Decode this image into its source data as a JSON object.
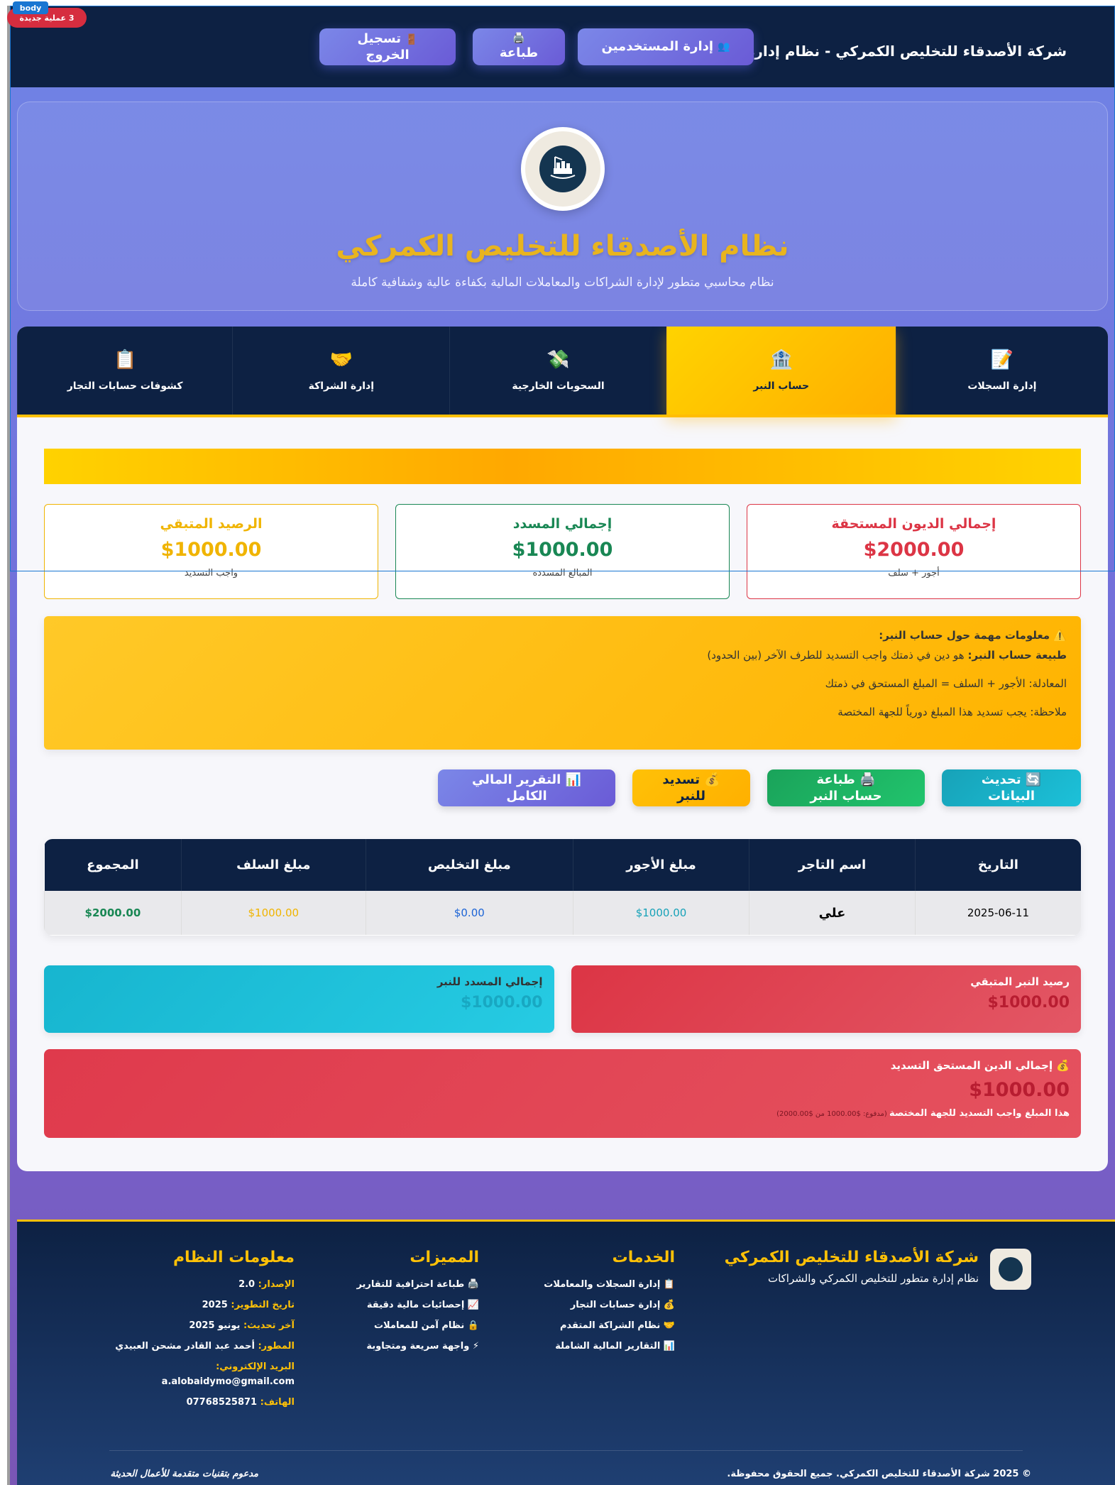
{
  "header": {
    "brand": "شركة الأصدقاء للتخليص الكمركي - نظام إدارة متكامل",
    "users_button": "إدارة المستخدمين",
    "print_button": "طباعة",
    "logout_button": "تسجيل الخروج"
  },
  "hero": {
    "title": "نظام الأصدقاء للتخليص الكمركي",
    "subtitle": "نظام محاسبي متطور لإدارة الشراكات والمعاملات المالية بكفاءة عالية وشفافية كاملة"
  },
  "tabs": [
    {
      "label": "إدارة السجلات",
      "icon": "📝"
    },
    {
      "label": "حساب النبر",
      "icon": "🏦"
    },
    {
      "label": "السحوبات الخارجية",
      "icon": "💸"
    },
    {
      "label": "إدارة الشراكة",
      "icon": "🤝"
    },
    {
      "label": "كشوفات حسابات التجار",
      "icon": "📋"
    }
  ],
  "cards": [
    {
      "title": "إجمالي الديون المستحقة",
      "value": "$2000.00",
      "sub": "أجور + سلف",
      "color": "#dc3545"
    },
    {
      "title": "إجمالي المسدد",
      "value": "$1000.00",
      "sub": "المبالغ المسددة",
      "color": "#198754"
    },
    {
      "title": "الرصيد المتبقي",
      "value": "$1000.00",
      "sub": "واجب التسديد",
      "color": "#f0b400"
    }
  ],
  "info": {
    "title": "⚠️ معلومات مهمة حول حساب النبر:",
    "nature_label": "طبيعة حساب النبر:",
    "nature_text": " هو دين في ذمتك واجب التسديد للطرف الآخر (بين الحدود)",
    "formula_label": "المعادلة:",
    "formula_text": " الأجور + السلف = المبلغ المستحق في ذمتك",
    "note_label": "ملاحظة:",
    "note_text": " يجب تسديد هذا المبلغ دورياً للجهة المختصة"
  },
  "actions": {
    "refresh": "🔄 تحديث البيانات",
    "print": "🖨️ طباعة حساب النبر",
    "pay": "💰 تسديد للنبر",
    "report": "📊 التقرير المالي الكامل"
  },
  "table": {
    "headers": [
      "التاريخ",
      "اسم التاجر",
      "مبلغ الأجور",
      "مبلغ التخليص",
      "مبلغ السلف",
      "المجموع"
    ],
    "rows": [
      [
        "2025-06-11",
        "علي",
        "$1000.00",
        "$0.00",
        "$1000.00",
        "$2000.00"
      ]
    ]
  },
  "summary": {
    "remaining_label": "رصيد النبر المتبقي",
    "remaining_value": "$1000.00",
    "paid_label": "إجمالي المسدد للنبر",
    "paid_value": "$1000.00"
  },
  "debt": {
    "label": "💰 إجمالي الدين المستحق التسديد",
    "value": "$1000.00",
    "note": "هذا المبلغ واجب التسديد للجهة المختصة",
    "note_detail": " (مدفوع: $1000.00 من $2000.00)"
  },
  "footer": {
    "company": "شركة الأصدقاء للتخليص الكمركي",
    "company_sub": "نظام إدارة متطور للتخليص الكمركي والشراكات",
    "services_title": "الخدمات",
    "services": [
      "📋 إدارة السجلات والمعاملات",
      "💰 إدارة حسابات التجار",
      "🤝 نظام الشراكة المتقدم",
      "📊 التقارير المالية الشاملة"
    ],
    "features_title": "المميزات",
    "features": [
      "🖨️ طباعة احترافية للتقارير",
      "📈 إحصائيات مالية دقيقة",
      "🔒 نظام آمن للمعاملات",
      "⚡ واجهة سريعة ومتجاوبة"
    ],
    "sysinfo_title": "معلومات النظام",
    "sysinfo": [
      {
        "k": "الإصدار:",
        "v": " 2.0"
      },
      {
        "k": "تاريخ التطوير:",
        "v": " 2025"
      },
      {
        "k": "آخر تحديث:",
        "v": " يونيو 2025"
      },
      {
        "k": "المطور:",
        "v": " أحمد عبد القادر مشحن العبيدي"
      },
      {
        "k": "البريد الإلكتروني:",
        "v": ""
      },
      {
        "k": "",
        "v": "a.alobaidymo@gmail.com"
      },
      {
        "k": "الهاتف:",
        "v": " 07768525871"
      }
    ],
    "copyright": "© 2025 شركة الأصدقاء للتخليص الكمركي. جميع الحقوق محفوظة.",
    "slogan": "مدعوم بتقنيات متقدمة للأعمال الحديثة"
  },
  "overlay": {
    "notification": "3 عملية جديدة",
    "body_tag": "body"
  }
}
